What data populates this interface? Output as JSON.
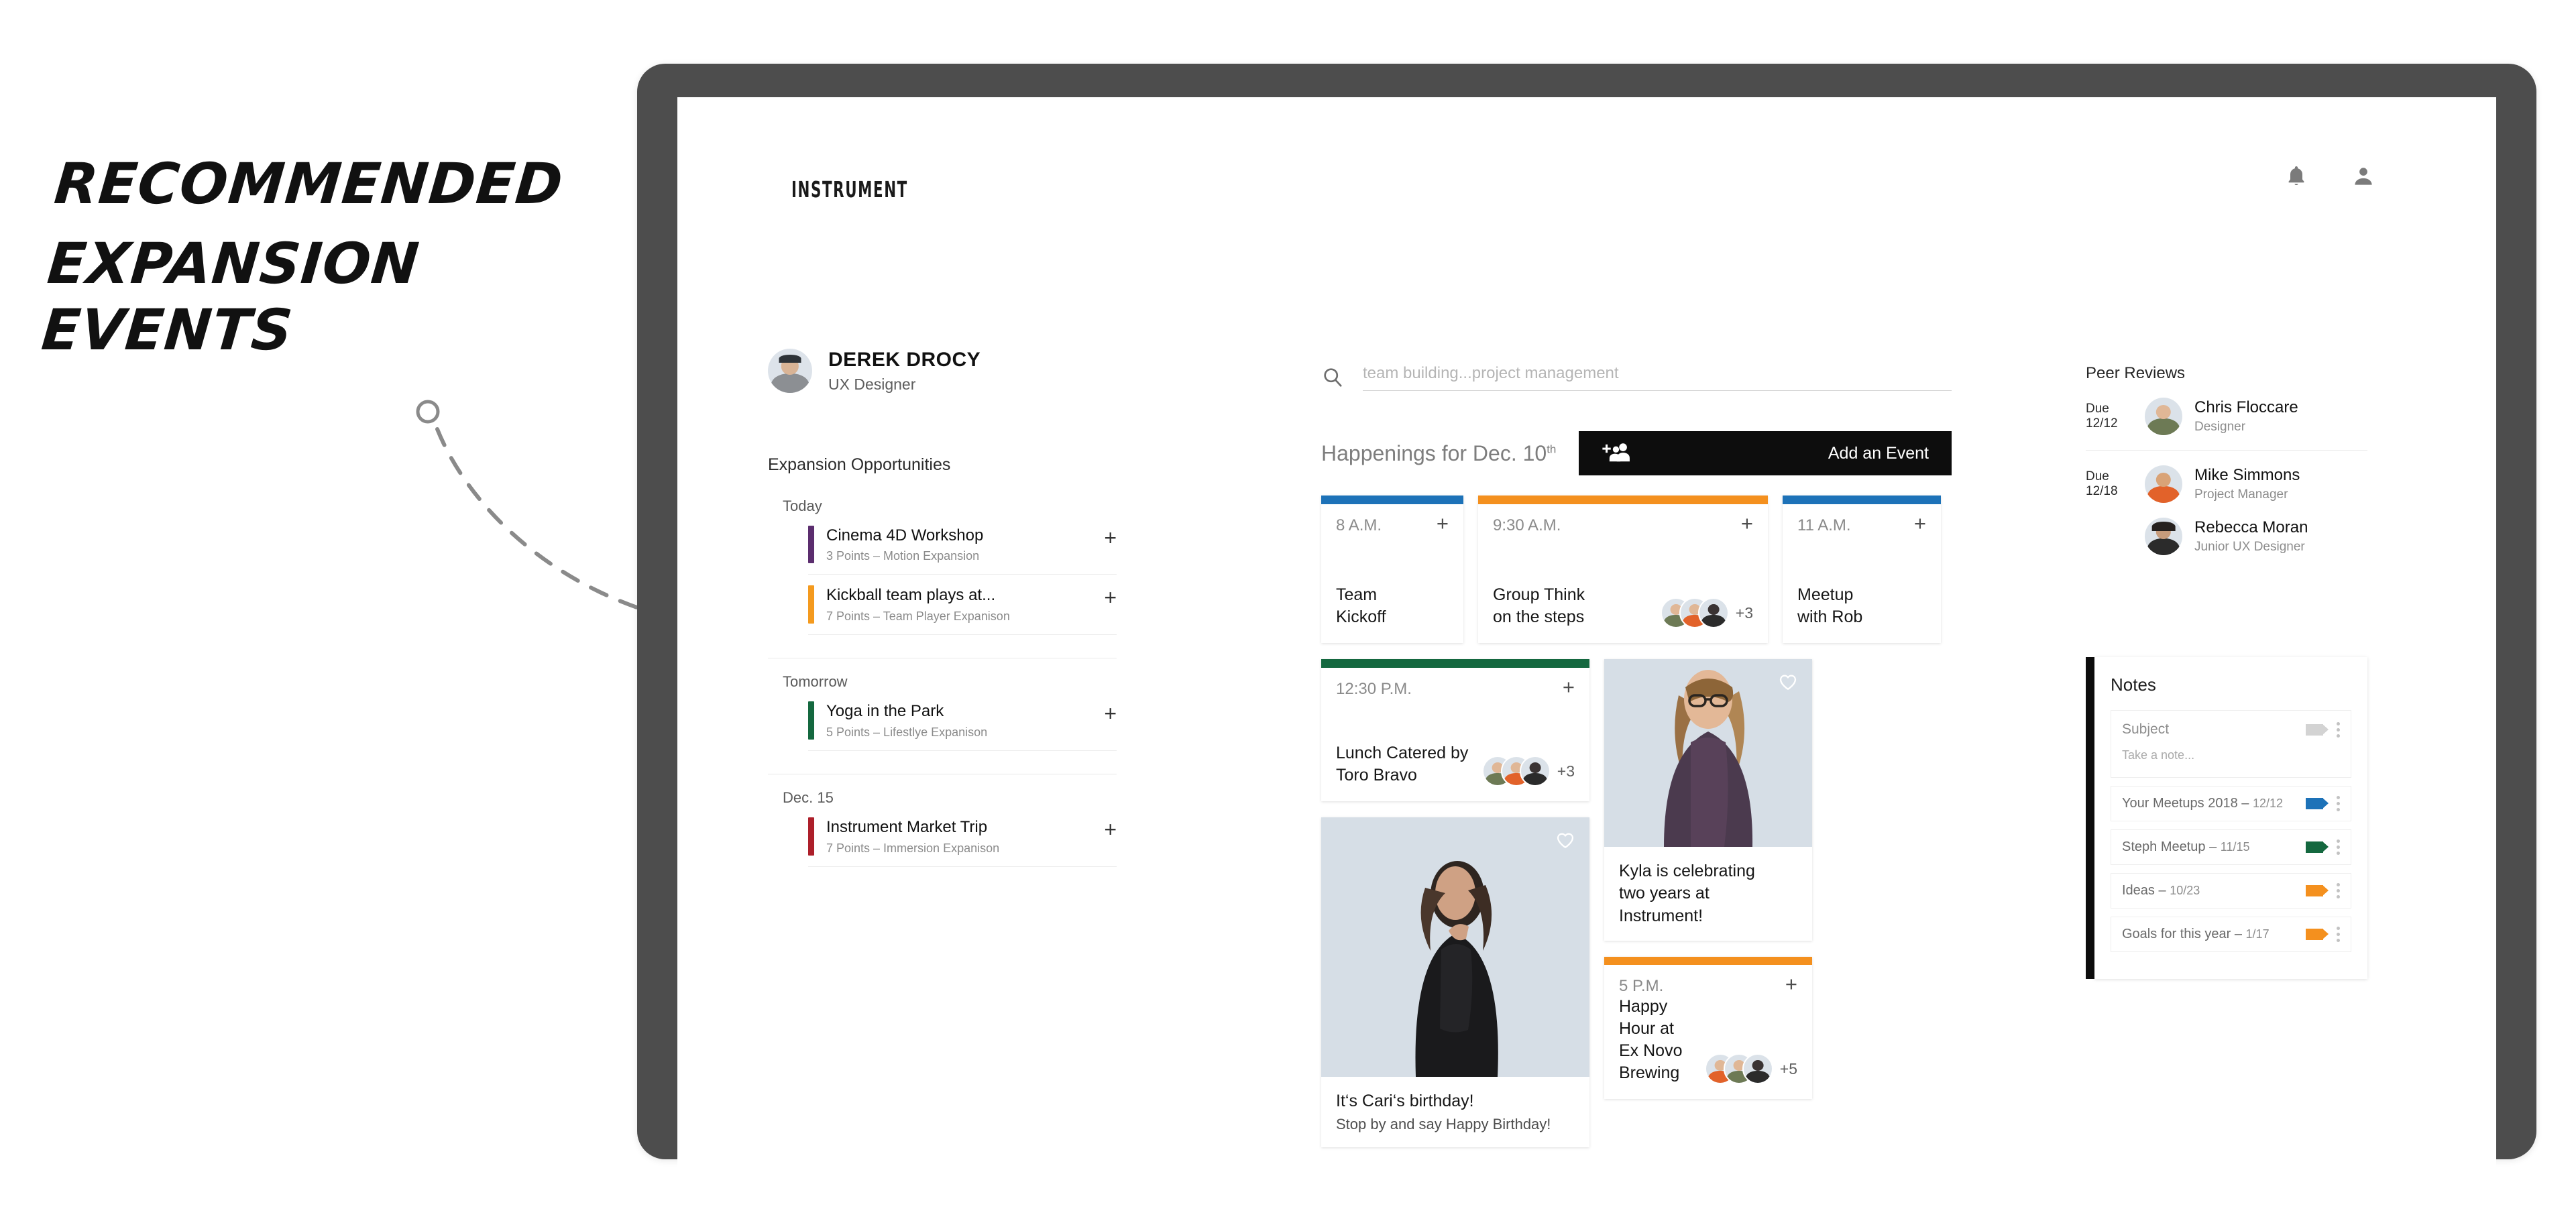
{
  "annotation": {
    "line1": "Recommended",
    "line2": "Expansion Events"
  },
  "app": {
    "logo": "INSTRUMENT",
    "header_icons": [
      {
        "name": "bell-icon",
        "label": "Notifications"
      },
      {
        "name": "person-icon",
        "label": "Account"
      }
    ]
  },
  "profile": {
    "name": "DEREK DROCY",
    "role": "UX Designer"
  },
  "sidebar": {
    "section_label": "Expansion Opportunities",
    "groups": [
      {
        "day": "Today",
        "items": [
          {
            "title": "Cinema 4D Workshop",
            "sub": "3 Points – Motion Expansion",
            "color": "#5b2d6e",
            "add": "+"
          },
          {
            "title": "Kickball team plays at...",
            "sub": "7 Points – Team Player Expanison",
            "color": "#f49a1e",
            "add": "+"
          }
        ]
      },
      {
        "day": "Tomorrow",
        "items": [
          {
            "title": "Yoga in the Park",
            "sub": "5 Points – Lifestlye Expanison",
            "color": "#14683f",
            "add": "+"
          }
        ]
      },
      {
        "day": "Dec. 15",
        "items": [
          {
            "title": "Instrument Market Trip",
            "sub": "7 Points – Immersion Expanison",
            "color": "#ad1f2a",
            "add": "+"
          }
        ]
      }
    ]
  },
  "search": {
    "value": "",
    "placeholder": "team building...project management"
  },
  "happenings": {
    "title": "Happenings for Dec. 10",
    "title_sup": "th",
    "add_event_label": "Add an Event"
  },
  "event_cards": {
    "row1": [
      {
        "time": "8 A.M.",
        "name": "Team\nKickoff",
        "bar": "#1d72b8",
        "plus": "+",
        "avatars": 0,
        "extra": ""
      },
      {
        "time": "9:30 A.M.",
        "name": "Group Think\non the steps",
        "bar": "#f4901e",
        "plus": "+",
        "avatars": 3,
        "extra": "+3"
      },
      {
        "time": "11 A.M.",
        "name": "Meetup\nwith Rob",
        "bar": "#1d72b8",
        "plus": "+",
        "avatars": 0,
        "extra": ""
      }
    ],
    "lunch": {
      "time": "12:30 P.M.",
      "name": "Lunch Catered by\nToro Bravo",
      "bar": "#14683f",
      "plus": "+",
      "avatars": 3,
      "extra": "+3"
    },
    "happy_hour": {
      "time": "5 P.M.",
      "name": "Happy Hour at\nEx Novo Brewing",
      "bar": "#f4901e",
      "plus": "+",
      "avatars": 3,
      "extra": "+5"
    }
  },
  "photo_cards": {
    "kyla": {
      "title": "Kyla is celebrating",
      "subtitle": "two years at Instrument!",
      "like_icon": "heart-icon"
    },
    "cari": {
      "title": "It‘s Cari‘s birthday!",
      "subtitle": "Stop by and say Happy Birthday!",
      "like_icon": "heart-icon"
    }
  },
  "peer_reviews": {
    "title": "Peer Reviews",
    "rows": [
      {
        "due_label": "Due",
        "due_date": "12/12",
        "name": "Chris Floccare",
        "role": "Designer"
      },
      {
        "due_label": "Due",
        "due_date": "12/18",
        "name": "Mike Simmons",
        "role": "Project Manager"
      },
      {
        "due_label": "",
        "due_date": "",
        "name": "Rebecca Moran",
        "role": "Junior UX Designer"
      }
    ]
  },
  "notes": {
    "title": "Notes",
    "new_note": {
      "subject_placeholder": "Subject",
      "body_placeholder": "Take a note...",
      "tag_color": "#d3d3d3"
    },
    "items": [
      {
        "label": "Your Meetups 2018",
        "date": "12/12",
        "tag_color": "#1d72b8"
      },
      {
        "label": "Steph Meetup",
        "date": "11/15",
        "tag_color": "#14683f"
      },
      {
        "label": "Ideas",
        "date": "10/23",
        "tag_color": "#f4901e"
      },
      {
        "label": "Goals for this year",
        "date": "1/17",
        "tag_color": "#f4901e"
      }
    ]
  },
  "colors": {
    "bezel": "#4d4d4d",
    "accent_blue": "#1d72b8",
    "accent_orange": "#f4901e",
    "accent_green": "#14683f",
    "accent_purple": "#5b2d6e",
    "accent_red": "#ad1f2a",
    "photo_bg": "#d6dee6"
  }
}
